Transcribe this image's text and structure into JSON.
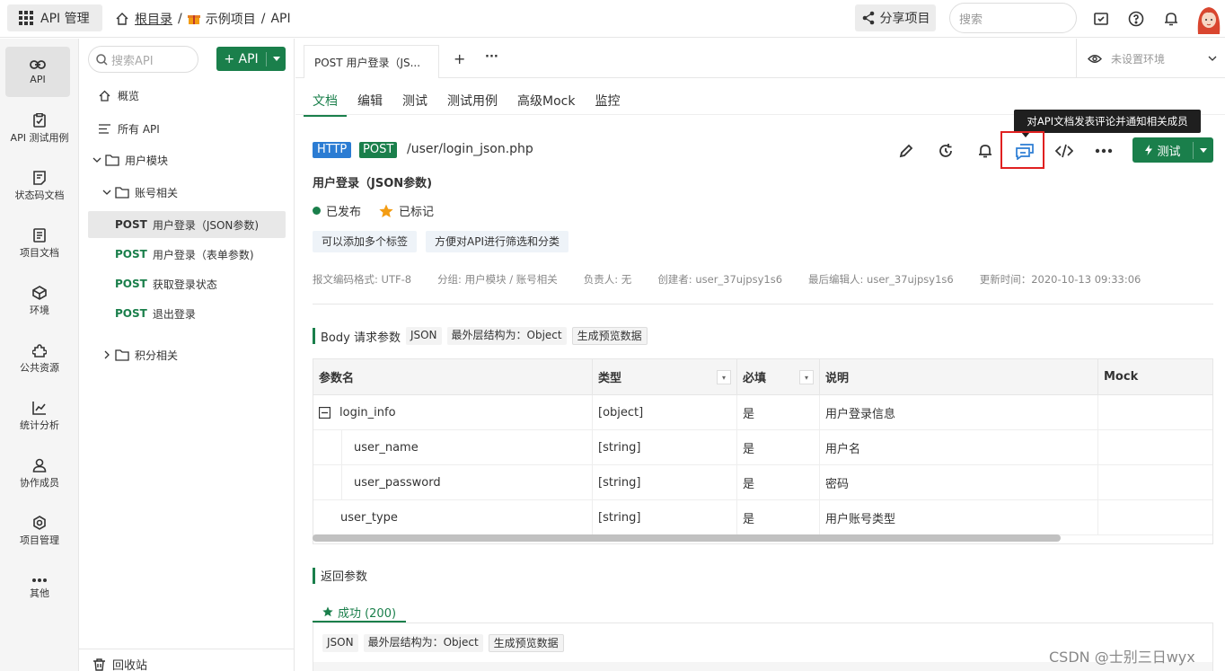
{
  "topbar": {
    "app_label": "API 管理",
    "breadcrumb": {
      "root": "根目录",
      "sep1": "/",
      "project": "示例项目",
      "sep2": "/",
      "current": "API"
    },
    "share_label": "分享项目",
    "search_placeholder": "搜索"
  },
  "rail": {
    "items": [
      {
        "label": "API",
        "icon": "link-icon"
      },
      {
        "label": "API 测试用例",
        "icon": "clipboard-check-icon"
      },
      {
        "label": "状态码文档",
        "icon": "doc-icon"
      },
      {
        "label": "项目文档",
        "icon": "file-icon"
      },
      {
        "label": "环境",
        "icon": "cube-icon"
      },
      {
        "label": "公共资源",
        "icon": "puzzle-icon"
      },
      {
        "label": "统计分析",
        "icon": "chart-icon"
      },
      {
        "label": "协作成员",
        "icon": "user-icon"
      },
      {
        "label": "项目管理",
        "icon": "gear-icon"
      },
      {
        "label": "其他",
        "icon": "more-icon"
      }
    ]
  },
  "tree": {
    "search_placeholder": "搜索API",
    "add_label": "+ API",
    "overview": "概览",
    "all_api": "所有 API",
    "folder_user": "用户模块",
    "folder_account": "账号相关",
    "apis": [
      {
        "method": "POST",
        "name": "用户登录（JSON参数)"
      },
      {
        "method": "POST",
        "name": "用户登录（表单参数)"
      },
      {
        "method": "POST",
        "name": "获取登录状态"
      },
      {
        "method": "POST",
        "name": "退出登录"
      }
    ],
    "folder_points": "积分相关",
    "trash": "回收站"
  },
  "tabs": {
    "open_tab": "POST 用户登录（JS...",
    "add": "+",
    "more": "···",
    "env": "未设置环境"
  },
  "subtabs": [
    "文档",
    "编辑",
    "测试",
    "测试用例",
    "高级Mock",
    "监控"
  ],
  "doc": {
    "protocol": "HTTP",
    "method": "POST",
    "path": "/user/login_json.php",
    "title": "用户登录（JSON参数)",
    "status": "已发布",
    "marked": "已标记",
    "tags": [
      "可以添加多个标签",
      "方便对API进行筛选和分类"
    ],
    "meta": [
      "报文编码格式: UTF-8",
      "分组: 用户模块 / 账号相关",
      "负责人: 无",
      "创建者: user_37ujpsy1s6",
      "最后编辑人: user_37ujpsy1s6",
      "更新时间：2020-10-13 09:33:06"
    ],
    "tooltip": "对API文档发表评论并通知相关成员",
    "test_label": "测试"
  },
  "body_params": {
    "heading": "Body 请求参数",
    "format": "JSON",
    "outer": "最外层结构为：Object",
    "gen": "生成预览数据",
    "columns": [
      "参数名",
      "类型",
      "必填",
      "说明",
      "Mock"
    ],
    "rows": [
      {
        "name": "login_info",
        "type": "[object]",
        "required": "是",
        "desc": "用户登录信息"
      },
      {
        "name": "user_name",
        "type": "[string]",
        "required": "是",
        "desc": "用户名"
      },
      {
        "name": "user_password",
        "type": "[string]",
        "required": "是",
        "desc": "密码"
      },
      {
        "name": "user_type",
        "type": "[string]",
        "required": "是",
        "desc": "用户账号类型"
      }
    ]
  },
  "response": {
    "heading": "返回参数",
    "tab": "成功 (200)",
    "format": "JSON",
    "outer": "最外层结构为：Object",
    "gen": "生成预览数据"
  },
  "watermark": "CSDN @士别三日wyx",
  "colors": {
    "accent": "#1a7f4b",
    "http": "#2b7cd3",
    "highlight": "#e02020",
    "star": "#f39c12"
  }
}
